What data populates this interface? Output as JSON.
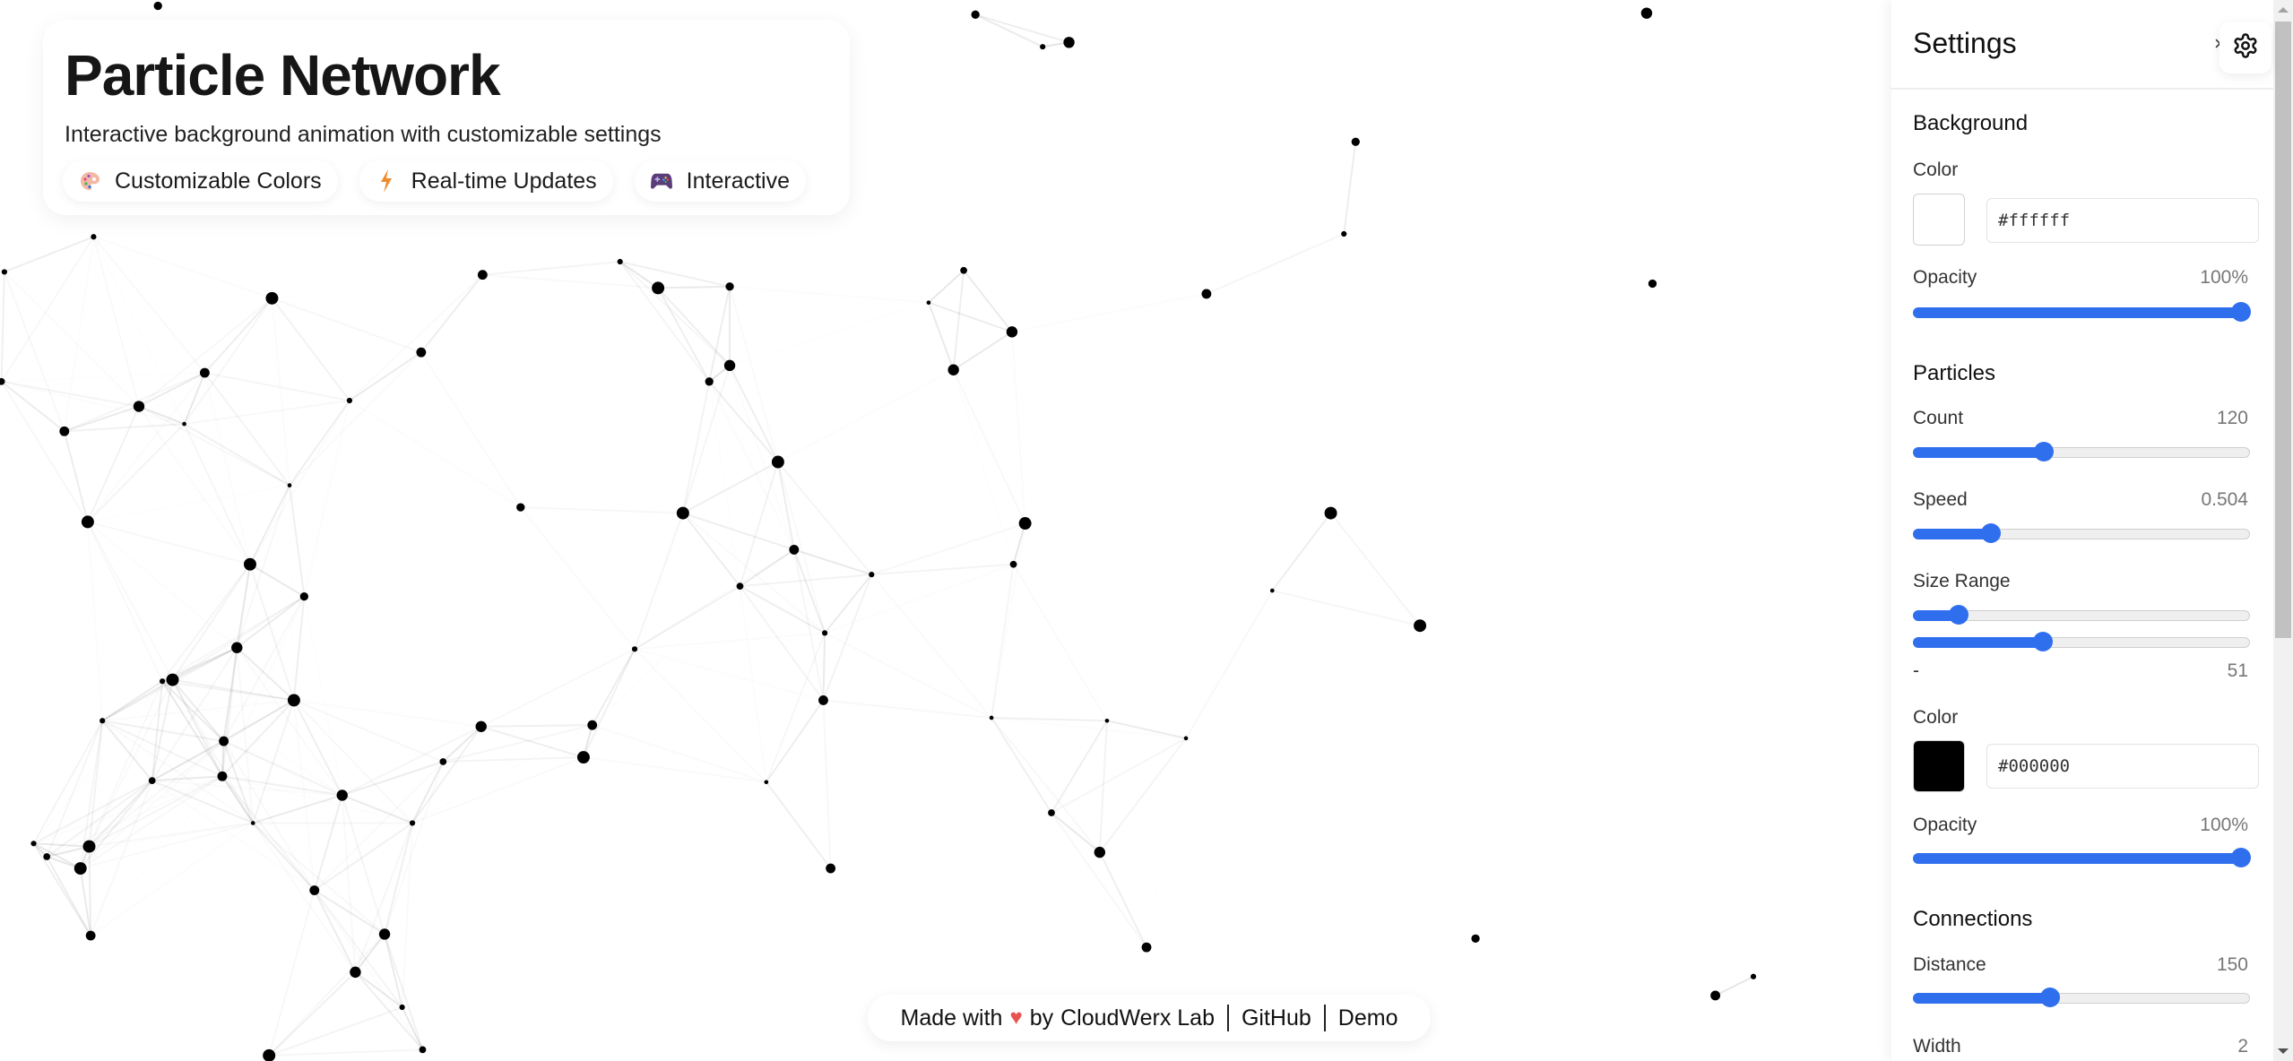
{
  "hero": {
    "title": "Particle Network",
    "subtitle": "Interactive background animation with customizable settings",
    "badges": [
      {
        "icon": "palette-icon",
        "label": "Customizable Colors"
      },
      {
        "icon": "lightning-icon",
        "label": "Real-time Updates"
      },
      {
        "icon": "gamepad-icon",
        "label": "Interactive"
      }
    ]
  },
  "footer": {
    "made_with": "Made with",
    "heart": "♥",
    "by": "by",
    "author": "CloudWerx Lab",
    "links": [
      "GitHub",
      "Demo"
    ]
  },
  "settings": {
    "title": "Settings",
    "close_glyph": "×",
    "background": {
      "section": "Background",
      "color_label": "Color",
      "color_value": "#ffffff",
      "opacity_label": "Opacity",
      "opacity_display": "100%",
      "opacity_fraction": 1.0
    },
    "particles": {
      "section": "Particles",
      "count_label": "Count",
      "count_display": "120",
      "count_fraction": 0.385,
      "speed_label": "Speed",
      "speed_display": "0.504",
      "speed_fraction": 0.228,
      "size_label": "Size Range",
      "size_min_fraction": 0.132,
      "size_max_fraction": 0.382,
      "size_min_display": "-",
      "size_max_display": "51",
      "color_label": "Color",
      "color_value": "#000000",
      "opacity_label": "Opacity",
      "opacity_display": "100%",
      "opacity_fraction": 1.0
    },
    "connections": {
      "section": "Connections",
      "distance_label": "Distance",
      "distance_display": "150",
      "distance_fraction": 0.405,
      "width_label": "Width",
      "width_display": "2"
    }
  },
  "colors": {
    "accent": "#2f6fee",
    "heart": "#e9534d",
    "particle": "#000000",
    "background": "#ffffff"
  }
}
